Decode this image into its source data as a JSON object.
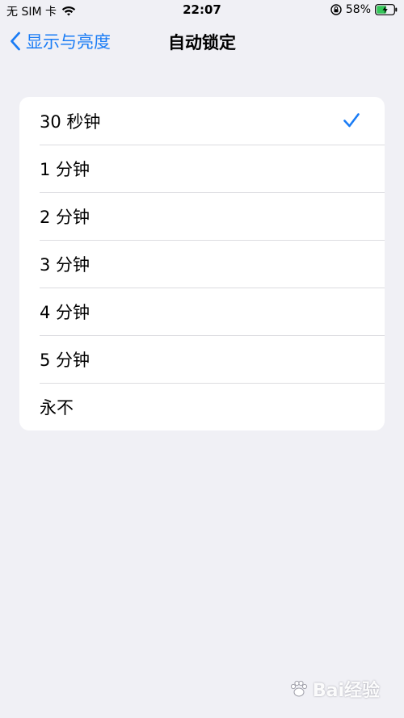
{
  "status_bar": {
    "carrier": "无 SIM 卡",
    "time": "22:07",
    "battery_percent": "58%",
    "battery_level": 0.58,
    "battery_color": "#34c759"
  },
  "nav": {
    "back_label": "显示与亮度",
    "title": "自动锁定"
  },
  "accent_color": "#1a7cf5",
  "options": [
    {
      "label": "30 秒钟",
      "selected": true
    },
    {
      "label": "1 分钟",
      "selected": false
    },
    {
      "label": "2 分钟",
      "selected": false
    },
    {
      "label": "3 分钟",
      "selected": false
    },
    {
      "label": "4 分钟",
      "selected": false
    },
    {
      "label": "5 分钟",
      "selected": false
    },
    {
      "label": "永不",
      "selected": false
    }
  ],
  "watermark": {
    "text": "Bai经验"
  }
}
